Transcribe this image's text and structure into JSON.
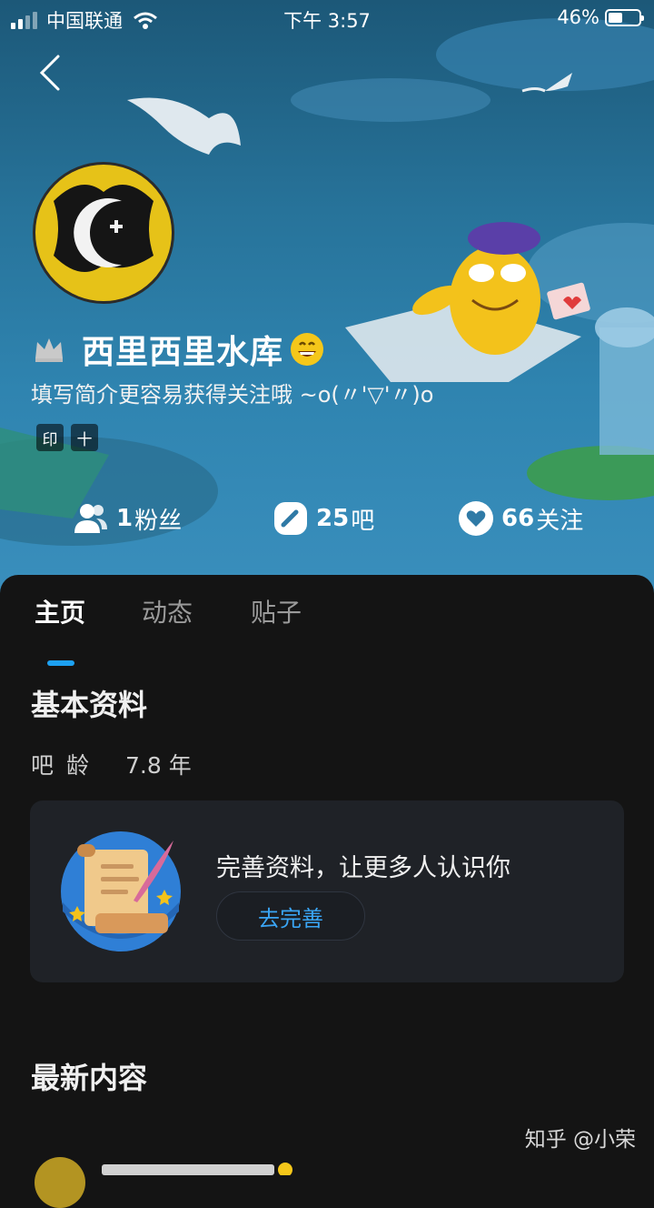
{
  "status_bar": {
    "carrier": "中国联通",
    "time": "下午 3:57",
    "battery_percent": "46%",
    "battery_level": 0.46
  },
  "header": {
    "back_icon": "chevron-left-icon"
  },
  "profile": {
    "username": "西里西里水库",
    "bio": "填写简介更容易获得关注哦 ~o(〃'▽'〃)o",
    "tags": [
      "印",
      "十"
    ],
    "badge_icon": "crown-icon",
    "emoji_icon": "grinning-face-icon"
  },
  "stats": [
    {
      "icon": "users-icon",
      "value": "1",
      "label": "粉丝"
    },
    {
      "icon": "bar-icon",
      "value": "25",
      "label": "吧"
    },
    {
      "icon": "heart-icon",
      "value": "66",
      "label": "关注"
    }
  ],
  "tabs": [
    {
      "label": "主页",
      "active": true
    },
    {
      "label": "动态",
      "active": false
    },
    {
      "label": "贴子",
      "active": false
    }
  ],
  "basic_info": {
    "title": "基本资料",
    "age_label": "吧龄",
    "age_value": "7.8 年"
  },
  "complete_card": {
    "title": "完善资料，让更多人认识你",
    "button": "去完善"
  },
  "latest": {
    "title": "最新内容"
  },
  "watermark": "知乎 @小荣",
  "colors": {
    "accent": "#1da1f2",
    "background": "#141414",
    "card": "#1f2227"
  }
}
